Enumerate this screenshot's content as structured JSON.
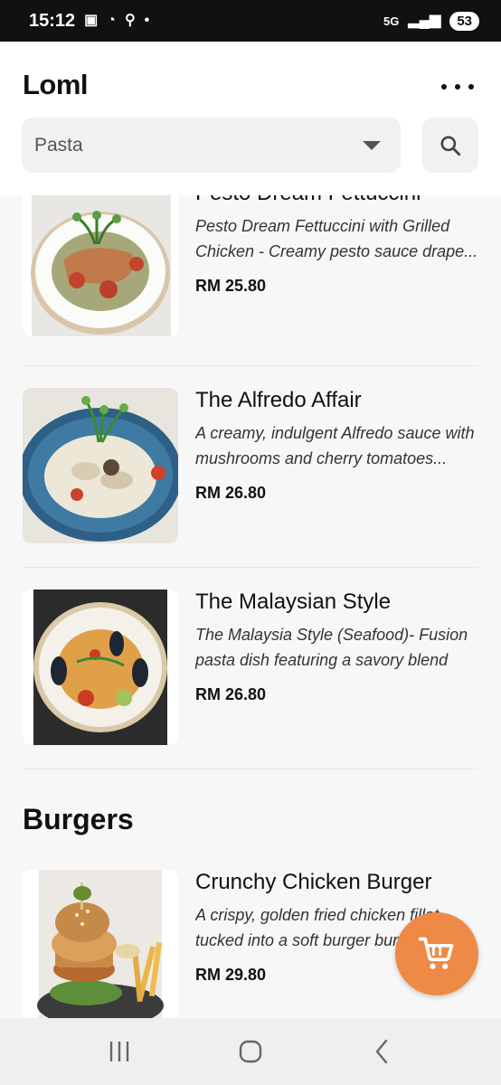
{
  "status_bar": {
    "time": "15:12",
    "network": "5G",
    "battery": "53"
  },
  "header": {
    "title": "Loml",
    "category_selected": "Pasta"
  },
  "menu": {
    "items": [
      {
        "name": "Pesto Dream Fettuccini",
        "description": "Pesto Dream Fettuccini with Grilled Chicken - Creamy pesto sauce drape...",
        "price": "RM 25.80"
      },
      {
        "name": "The Alfredo Affair",
        "description": "A creamy, indulgent Alfredo sauce with mushrooms and cherry tomatoes...",
        "price": "RM 26.80"
      },
      {
        "name": "The Malaysian Style",
        "description": "The Malaysia Style (Seafood)- Fusion pasta dish featuring a savory blend of...",
        "price": "RM 26.80"
      }
    ],
    "burgers_section": {
      "title": "Burgers",
      "items": [
        {
          "name": "Crunchy Chicken Burger",
          "description": "A crispy, golden fried chicken fillet tucked into a soft burger bun...",
          "price": "RM 29.80"
        }
      ]
    }
  },
  "colors": {
    "accent": "#ee8a45",
    "background": "#f7f7f7"
  }
}
